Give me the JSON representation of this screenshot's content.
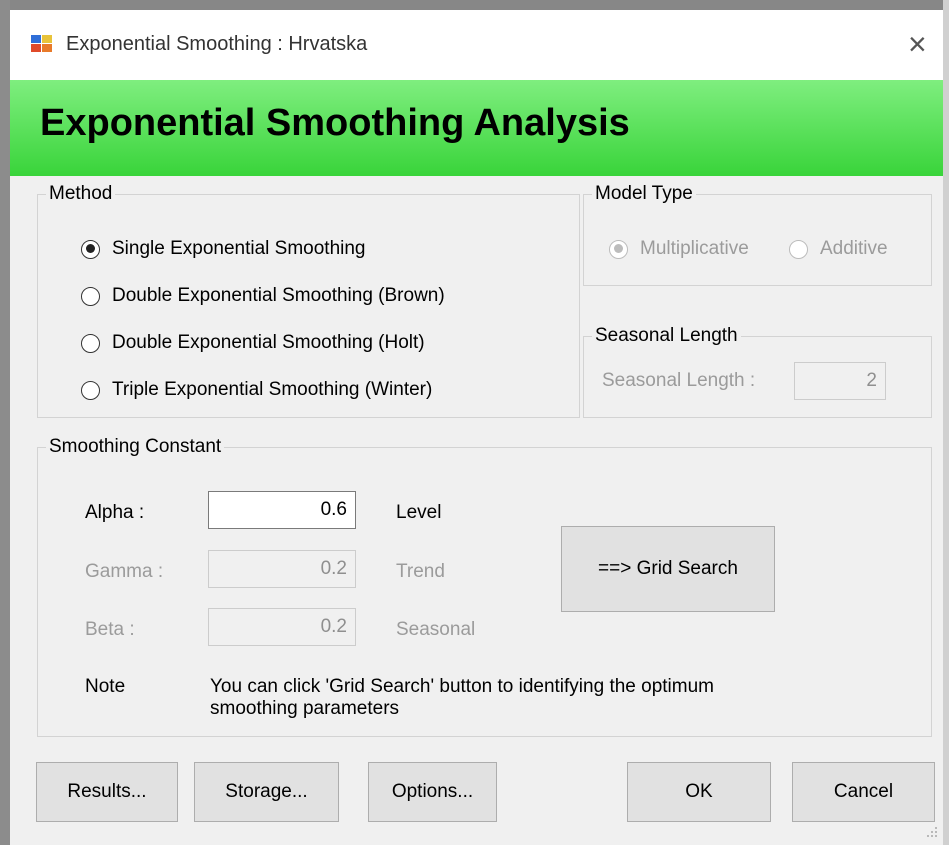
{
  "window": {
    "title": "Exponential Smoothing : Hrvatska",
    "close_symbol": "×"
  },
  "banner": {
    "title": "Exponential Smoothing Analysis",
    "color": "#39d43a"
  },
  "method": {
    "legend": "Method",
    "options": [
      {
        "label": "Single Exponential Smoothing",
        "checked": true
      },
      {
        "label": "Double Exponential Smoothing (Brown)",
        "checked": false
      },
      {
        "label": "Double Exponential Smoothing (Holt)",
        "checked": false
      },
      {
        "label": "Triple Exponential Smoothing (Winter)",
        "checked": false
      }
    ]
  },
  "model_type": {
    "legend": "Model Type",
    "options": [
      {
        "label": "Multiplicative",
        "checked": true
      },
      {
        "label": "Additive",
        "checked": false
      }
    ]
  },
  "seasonal_length": {
    "legend": "Seasonal Length",
    "label": "Seasonal Length :",
    "value": "2"
  },
  "smoothing": {
    "legend": "Smoothing Constant",
    "alpha": {
      "label": "Alpha :",
      "value": "0.6",
      "desc": "Level"
    },
    "gamma": {
      "label": "Gamma :",
      "value": "0.2",
      "desc": "Trend"
    },
    "beta": {
      "label": "Beta :",
      "value": "0.2",
      "desc": "Seasonal"
    },
    "grid_search_label": "==> Grid Search",
    "note_label": "Note",
    "note_text_line1": "You can click 'Grid Search' button to identifying the optimum",
    "note_text_line2": "smoothing parameters"
  },
  "buttons": {
    "results": "Results...",
    "storage": "Storage...",
    "options": "Options...",
    "ok": "OK",
    "cancel": "Cancel"
  }
}
